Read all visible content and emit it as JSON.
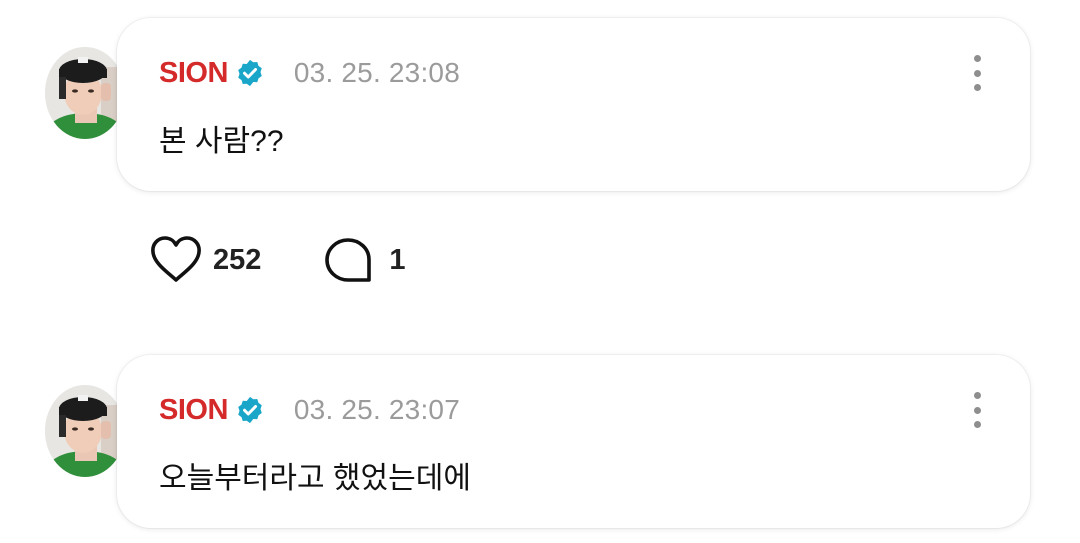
{
  "colors": {
    "author": "#d42a2a",
    "verified_badge": "#1aa6c9",
    "timestamp": "#9b9b9b",
    "text": "#111111"
  },
  "posts": [
    {
      "author": "SION",
      "verified": true,
      "timestamp": "03. 25. 23:08",
      "message": "본 사람??",
      "likes": "252",
      "comments": "1",
      "icons": [
        "avatar",
        "verified-badge-icon",
        "more-vertical-icon",
        "heart-icon",
        "comment-bubble-icon"
      ]
    },
    {
      "author": "SION",
      "verified": true,
      "timestamp": "03. 25. 23:07",
      "message": "오늘부터라고 했었는데에",
      "icons": [
        "avatar",
        "verified-badge-icon",
        "more-vertical-icon"
      ]
    }
  ]
}
